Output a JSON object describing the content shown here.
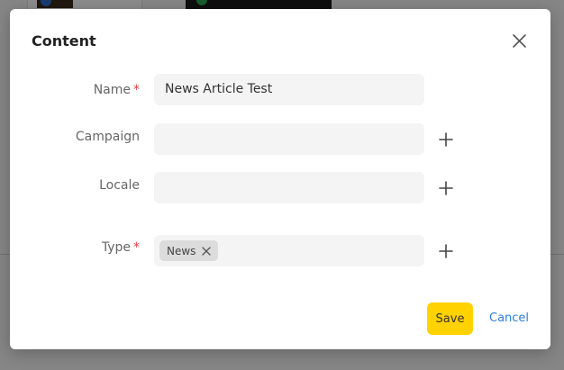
{
  "modal": {
    "title": "Content",
    "fields": {
      "name": {
        "label": "Name",
        "required_mark": "*",
        "value": "News Article Test"
      },
      "campaign": {
        "label": "Campaign",
        "value": ""
      },
      "locale": {
        "label": "Locale",
        "value": ""
      },
      "type": {
        "label": "Type",
        "required_mark": "*",
        "tags": [
          "News"
        ]
      }
    },
    "actions": {
      "save_label": "Save",
      "cancel_label": "Cancel"
    }
  },
  "colors": {
    "primary_button": "#ffd200",
    "link": "#2f7fd6",
    "required": "#e53935",
    "input_background": "#f4f4f4",
    "tag_background": "#dcdcdc"
  },
  "icons": {
    "close": "close-icon",
    "add": "plus-icon",
    "tag_remove": "close-icon"
  }
}
